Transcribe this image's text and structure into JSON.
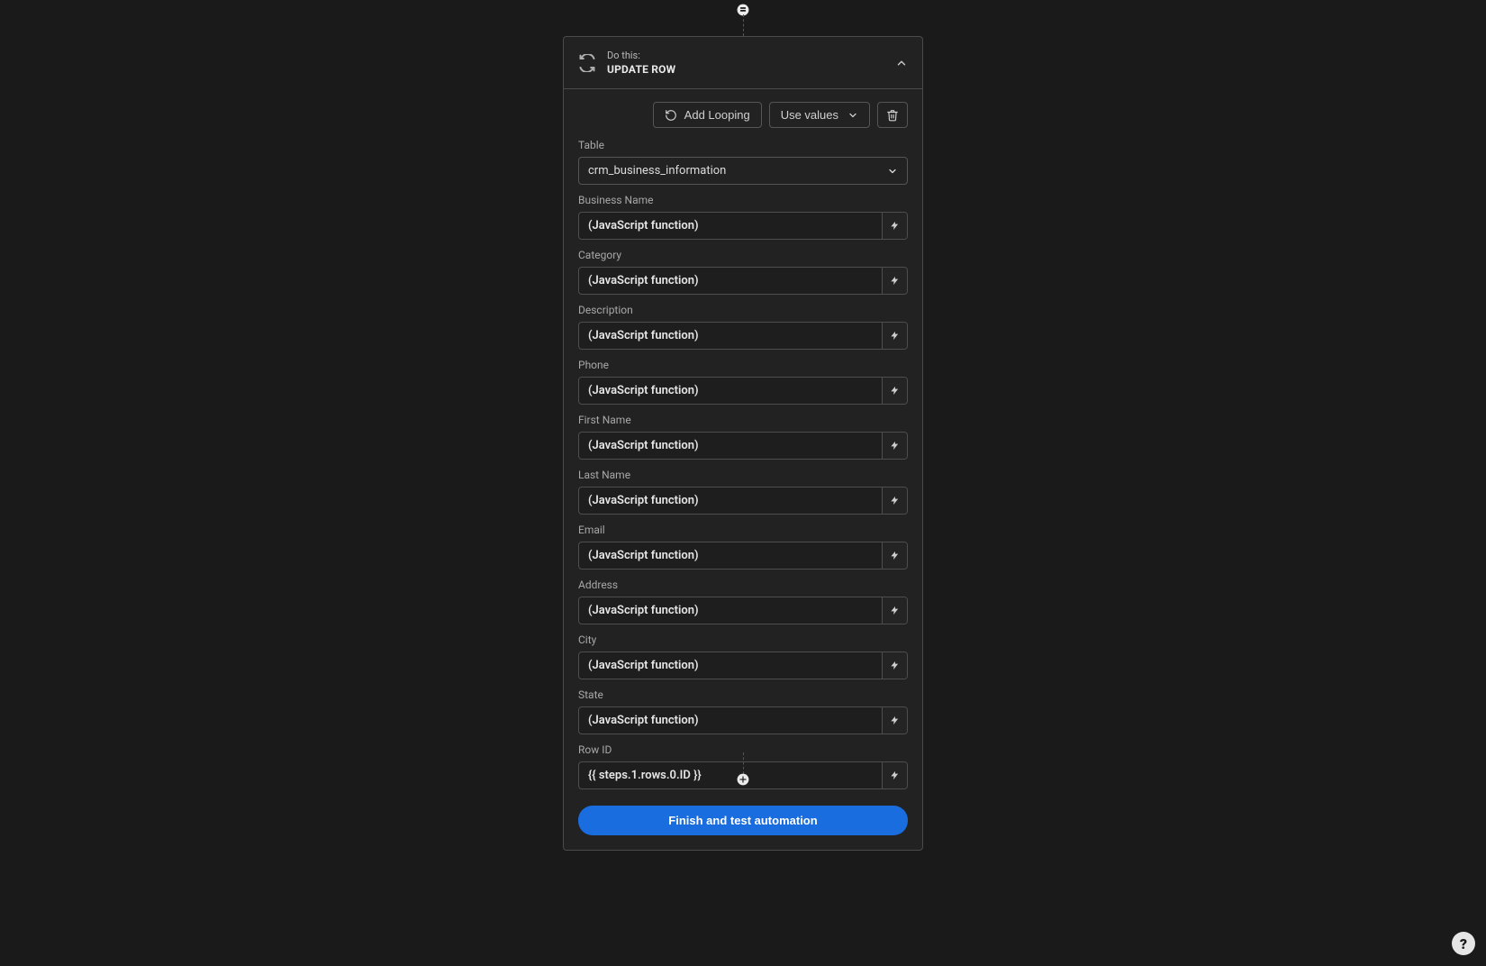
{
  "panel": {
    "pretitle": "Do this:",
    "title": "UPDATE ROW",
    "toolbar": {
      "add_looping": "Add Looping",
      "use_values": "Use values"
    },
    "table_label": "Table",
    "table_value": "crm_business_information",
    "fields": [
      {
        "label": "Business Name",
        "value": "(JavaScript function)"
      },
      {
        "label": "Category",
        "value": "(JavaScript function)"
      },
      {
        "label": "Description",
        "value": "(JavaScript function)"
      },
      {
        "label": "Phone",
        "value": "(JavaScript function)"
      },
      {
        "label": "First Name",
        "value": "(JavaScript function)"
      },
      {
        "label": "Last Name",
        "value": "(JavaScript function)"
      },
      {
        "label": "Email",
        "value": "(JavaScript function)"
      },
      {
        "label": "Address",
        "value": "(JavaScript function)"
      },
      {
        "label": "City",
        "value": "(JavaScript function)"
      },
      {
        "label": "State",
        "value": "(JavaScript function)"
      },
      {
        "label": "Row ID",
        "value": "{{ steps.1.rows.0.ID }}"
      }
    ],
    "submit_label": "Finish and test automation"
  },
  "help": "?"
}
